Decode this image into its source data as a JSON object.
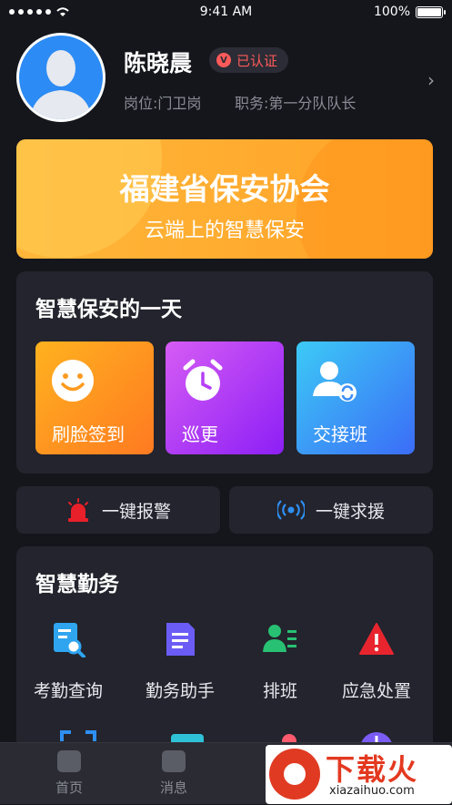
{
  "status_bar": {
    "time": "9:41 AM",
    "battery": "100%"
  },
  "profile": {
    "name": "陈晓晨",
    "verified_label": "已认证",
    "post": "岗位:门卫岗",
    "duty": "职务:第一分队队长"
  },
  "banner": {
    "title": "福建省保安协会",
    "subtitle": "云端上的智慧保安"
  },
  "day_section": {
    "title": "智慧保安的一天",
    "tiles": [
      {
        "label": "刷脸签到",
        "icon": "smiley-face-icon"
      },
      {
        "label": "巡更",
        "icon": "alarm-clock-icon"
      },
      {
        "label": "交接班",
        "icon": "user-swap-icon"
      }
    ]
  },
  "quick_actions": [
    {
      "label": "一键报警",
      "icon": "siren-icon"
    },
    {
      "label": "一键求援",
      "icon": "broadcast-icon"
    }
  ],
  "duty_section": {
    "title": "智慧勤务",
    "items": [
      {
        "label": "考勤查询",
        "icon": "attendance-search-icon"
      },
      {
        "label": "勤务助手",
        "icon": "document-icon"
      },
      {
        "label": "排班",
        "icon": "team-schedule-icon"
      },
      {
        "label": "应急处置",
        "icon": "warning-icon"
      }
    ]
  },
  "tabbar": [
    {
      "label": "首页",
      "icon": "home-icon"
    },
    {
      "label": "消息",
      "icon": "message-icon"
    }
  ],
  "watermark": {
    "name": "下载火",
    "url": "xiazaihuo.com"
  },
  "colors": {
    "background": "#15161c",
    "card": "#23242d",
    "banner": "#ffa227",
    "verified": "#ff5a5a"
  }
}
